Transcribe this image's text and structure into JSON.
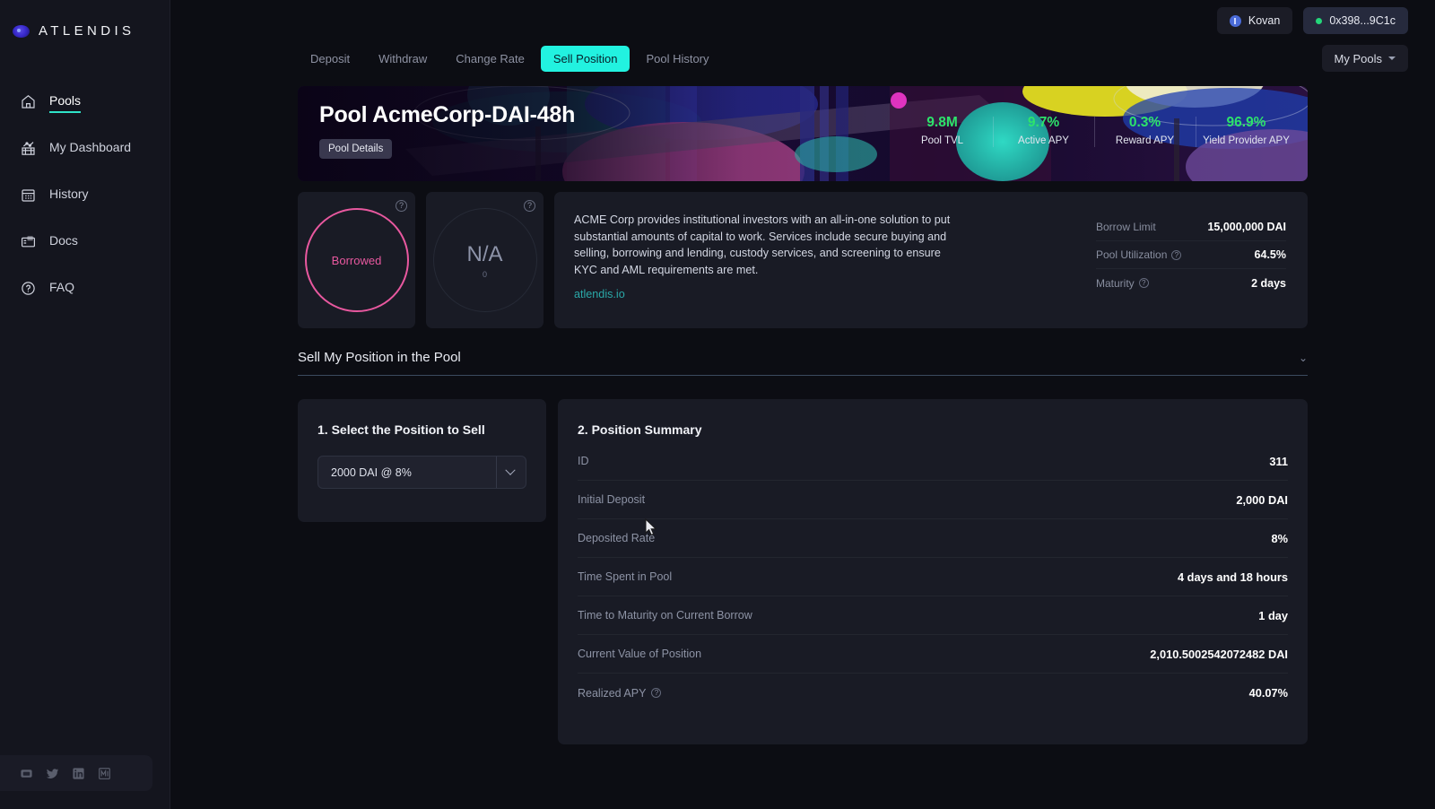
{
  "brand": {
    "name": "ATLENDIS",
    "logo_icon": "atlendis-logo-icon"
  },
  "sidebar": {
    "items": [
      {
        "label": "Pools",
        "icon": "home-icon",
        "active": true
      },
      {
        "label": "My Dashboard",
        "icon": "bar-chart-icon",
        "active": false
      },
      {
        "label": "History",
        "icon": "calendar-icon",
        "active": false
      },
      {
        "label": "Docs",
        "icon": "docs-icon",
        "active": false
      },
      {
        "label": "FAQ",
        "icon": "question-circle-icon",
        "active": false
      }
    ],
    "socials": [
      {
        "name": "discord-icon"
      },
      {
        "name": "twitter-icon"
      },
      {
        "name": "linkedin-icon"
      },
      {
        "name": "medium-icon"
      }
    ]
  },
  "topbar": {
    "network_label": "Kovan",
    "wallet_label": "0x398...9C1c"
  },
  "tabs": [
    {
      "label": "Deposit",
      "active": false
    },
    {
      "label": "Withdraw",
      "active": false
    },
    {
      "label": "Change Rate",
      "active": false
    },
    {
      "label": "Sell Position",
      "active": true
    },
    {
      "label": "Pool History",
      "active": false
    }
  ],
  "my_pools_button": {
    "label": "My Pools",
    "icon": "chevron-down-icon"
  },
  "banner": {
    "title": "Pool AcmeCorp-DAI-48h",
    "details_button": "Pool Details",
    "stats": [
      {
        "value": "9.8M",
        "label": "Pool TVL"
      },
      {
        "value": "9.7%",
        "label": "Active APY"
      },
      {
        "value": "0.3%",
        "label": "Reward APY"
      },
      {
        "value": "96.9%",
        "label": "Yield Provider APY"
      }
    ]
  },
  "gauges": [
    {
      "label": "Borrowed",
      "sub": "",
      "help_icon": "help-icon",
      "color": "#e8589f"
    },
    {
      "label": "N/A",
      "sub": "0",
      "help_icon": "help-icon",
      "color": "#8d93a8"
    }
  ],
  "description": {
    "paragraph": "ACME Corp provides institutional investors with an all-in-one solution to put substantial amounts of capital to work. Services include secure buying and selling, borrowing and lending, custody services, and screening to ensure KYC and AML requirements are met.",
    "link": "atlendis.io"
  },
  "pool_stats": [
    {
      "label": "Borrow Limit",
      "value": "15,000,000 DAI",
      "help": false
    },
    {
      "label": "Pool Utilization",
      "value": "64.5%",
      "help": true
    },
    {
      "label": "Maturity",
      "value": "2 days",
      "help": true
    }
  ],
  "section": {
    "title": "Sell My Position in the Pool",
    "chevron_icon": "chevron-down-icon"
  },
  "select_panel": {
    "title": "1. Select the Position to Sell",
    "selected_option": "2000 DAI @ 8%",
    "dropdown_icon": "chevron-down-icon"
  },
  "summary_panel": {
    "title": "2. Position Summary",
    "rows": [
      {
        "label": "ID",
        "value": "311",
        "help": false
      },
      {
        "label": "Initial Deposit",
        "value": "2,000 DAI",
        "help": false
      },
      {
        "label": "Deposited Rate",
        "value": "8%",
        "help": false
      },
      {
        "label": "Time Spent in Pool",
        "value": "4 days and 18 hours",
        "help": false
      },
      {
        "label": "Time to Maturity on Current Borrow",
        "value": "1 day",
        "help": false
      },
      {
        "label": "Current Value of Position",
        "value": "2,010.5002542072482 DAI",
        "help": false
      },
      {
        "label": "Realized APY",
        "value": "40.07%",
        "help": true
      }
    ]
  },
  "colors": {
    "accent_cyan": "#22f2e0",
    "accent_green": "#2de36b",
    "accent_pink": "#e8589f",
    "link_teal": "#2aa8a8",
    "panel_bg": "#191b25",
    "sidebar_bg": "#14151e"
  }
}
